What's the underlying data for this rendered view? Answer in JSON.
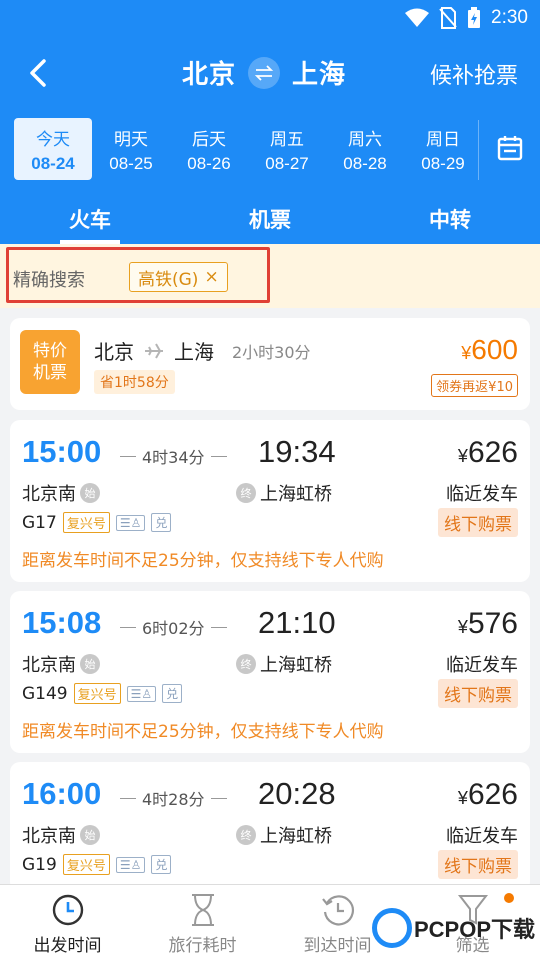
{
  "status_bar": {
    "time": "2:30"
  },
  "nav": {
    "from": "北京",
    "to": "上海",
    "waitlist": "候补抢票"
  },
  "dates": [
    {
      "week": "今天",
      "date": "08-24",
      "active": true
    },
    {
      "week": "明天",
      "date": "08-25"
    },
    {
      "week": "后天",
      "date": "08-26"
    },
    {
      "week": "周五",
      "date": "08-27"
    },
    {
      "week": "周六",
      "date": "08-28"
    },
    {
      "week": "周日",
      "date": "08-29"
    }
  ],
  "tabs": [
    "火车",
    "机票",
    "中转"
  ],
  "precise_search": {
    "label": "精确搜索",
    "chip": "高铁(G)",
    "chip_close": "×"
  },
  "flight_offer": {
    "badge_line1": "特价",
    "badge_line2": "机票",
    "from": "北京",
    "to": "上海",
    "duration": "2小时30分",
    "save": "省1时58分",
    "currency": "¥",
    "price": "600",
    "coupon": "领券再返¥10"
  },
  "trains": [
    {
      "dep": "15:00",
      "duration": "4时34分",
      "arr": "19:34",
      "currency": "¥",
      "price": "626",
      "from": "北京南",
      "from_tag": "始",
      "to": "上海虹桥",
      "to_tag": "终",
      "status": "临近发车",
      "number": "G17",
      "type": "复兴号",
      "icon1": "☰♙",
      "icon2": "兑",
      "buy": "线下购票",
      "notice": "距离发车时间不足25分钟，仅支持线下专人代购"
    },
    {
      "dep": "15:08",
      "duration": "6时02分",
      "arr": "21:10",
      "currency": "¥",
      "price": "576",
      "from": "北京南",
      "from_tag": "始",
      "to": "上海虹桥",
      "to_tag": "终",
      "status": "临近发车",
      "number": "G149",
      "type": "复兴号",
      "icon1": "☰♙",
      "icon2": "兑",
      "buy": "线下购票",
      "notice": "距离发车时间不足25分钟，仅支持线下专人代购"
    },
    {
      "dep": "16:00",
      "duration": "4时28分",
      "arr": "20:28",
      "currency": "¥",
      "price": "626",
      "from": "北京南",
      "from_tag": "始",
      "to": "上海虹桥",
      "to_tag": "终",
      "status": "临近发车",
      "number": "G19",
      "type": "复兴号",
      "icon1": "☰♙",
      "icon2": "兑",
      "buy": "线下购票"
    }
  ],
  "bottom": [
    {
      "label": "出发时间",
      "icon": "clock-icon"
    },
    {
      "label": "旅行耗时",
      "icon": "hourglass-icon"
    },
    {
      "label": "到达时间",
      "icon": "clock-back-icon"
    },
    {
      "label": "筛选",
      "icon": "filter-icon"
    }
  ],
  "watermark": {
    "text": "PCPOP下载"
  },
  "colors": {
    "primary": "#1e8bf6",
    "orange": "#f57a00",
    "highlight": "#e04035"
  }
}
